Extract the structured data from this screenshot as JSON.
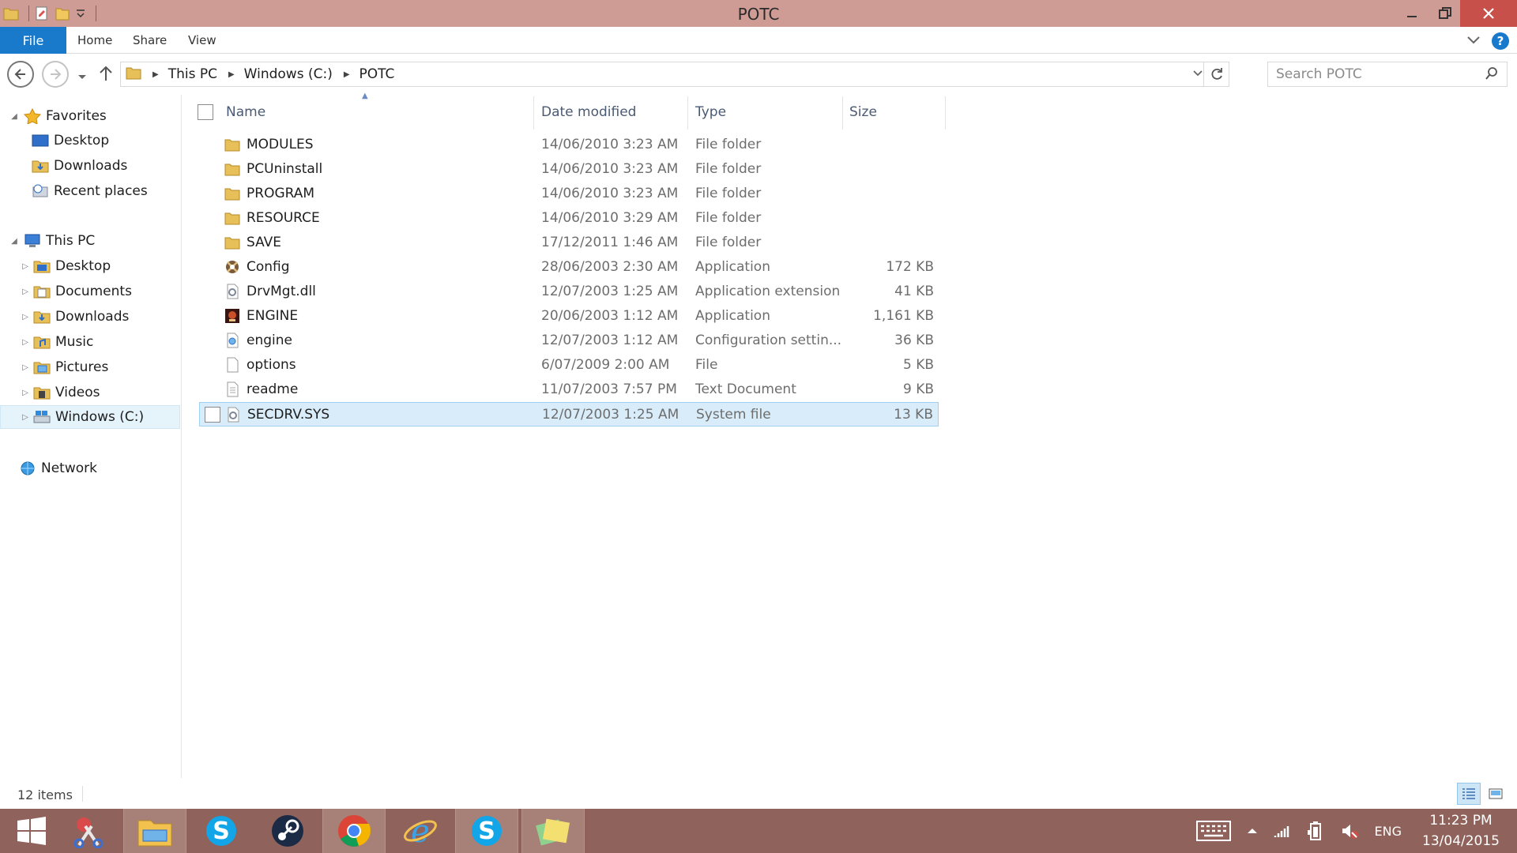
{
  "window": {
    "title": "POTC"
  },
  "ribbon": {
    "file": "File",
    "tabs": [
      "Home",
      "Share",
      "View"
    ]
  },
  "address": {
    "crumbs": [
      "This PC",
      "Windows (C:)",
      "POTC"
    ],
    "search_placeholder": "Search POTC"
  },
  "navpane": {
    "favorites": {
      "label": "Favorites",
      "items": [
        "Desktop",
        "Downloads",
        "Recent places"
      ]
    },
    "thispc": {
      "label": "This PC",
      "items": [
        "Desktop",
        "Documents",
        "Downloads",
        "Music",
        "Pictures",
        "Videos",
        "Windows (C:)"
      ]
    },
    "network": {
      "label": "Network"
    }
  },
  "columns": {
    "name": "Name",
    "date": "Date modified",
    "type": "Type",
    "size": "Size"
  },
  "files": [
    {
      "name": "MODULES",
      "date": "14/06/2010 3:23 AM",
      "type": "File folder",
      "size": "",
      "icon": "folder-icon"
    },
    {
      "name": "PCUninstall",
      "date": "14/06/2010 3:23 AM",
      "type": "File folder",
      "size": "",
      "icon": "folder-icon"
    },
    {
      "name": "PROGRAM",
      "date": "14/06/2010 3:23 AM",
      "type": "File folder",
      "size": "",
      "icon": "folder-icon"
    },
    {
      "name": "RESOURCE",
      "date": "14/06/2010 3:29 AM",
      "type": "File folder",
      "size": "",
      "icon": "folder-icon"
    },
    {
      "name": "SAVE",
      "date": "17/12/2011 1:46 AM",
      "type": "File folder",
      "size": "",
      "icon": "folder-icon"
    },
    {
      "name": "Config",
      "date": "28/06/2003 2:30 AM",
      "type": "Application",
      "size": "172 KB",
      "icon": "config-app-icon"
    },
    {
      "name": "DrvMgt.dll",
      "date": "12/07/2003 1:25 AM",
      "type": "Application extension",
      "size": "41 KB",
      "icon": "dll-file-icon"
    },
    {
      "name": "ENGINE",
      "date": "20/06/2003 1:12 AM",
      "type": "Application",
      "size": "1,161 KB",
      "icon": "engine-app-icon"
    },
    {
      "name": "engine",
      "date": "12/07/2003 1:12 AM",
      "type": "Configuration settin...",
      "size": "36 KB",
      "icon": "settings-file-icon"
    },
    {
      "name": "options",
      "date": "6/07/2009 2:00 AM",
      "type": "File",
      "size": "5 KB",
      "icon": "blank-file-icon"
    },
    {
      "name": "readme",
      "date": "11/07/2003 7:57 PM",
      "type": "Text Document",
      "size": "9 KB",
      "icon": "text-file-icon"
    },
    {
      "name": "SECDRV.SYS",
      "date": "12/07/2003 1:25 AM",
      "type": "System file",
      "size": "13 KB",
      "icon": "system-file-icon"
    }
  ],
  "status": {
    "count": "12 items"
  },
  "tray": {
    "lang": "ENG",
    "time": "11:23 PM",
    "date": "13/04/2015"
  },
  "colors": {
    "titlebar": "#cf9c95",
    "accent": "#1979ca",
    "taskbar": "#8f635b",
    "selection": "#d9ecf9"
  }
}
